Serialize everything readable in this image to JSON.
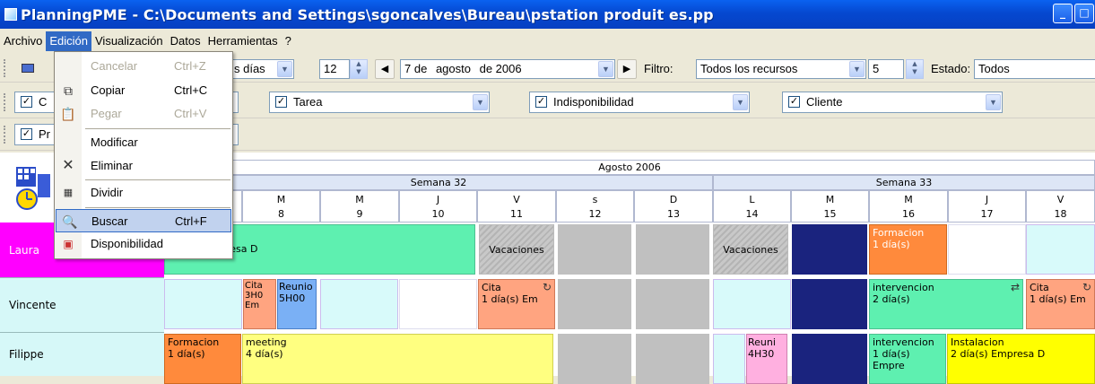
{
  "window": {
    "title": "PlanningPME - C:\\Documents and Settings\\sgoncalves\\Bureau\\pstation produit es.pp",
    "minimize": "_",
    "restore": "□"
  },
  "menubar": [
    "Archivo",
    "Edición",
    "Visualización",
    "Datos",
    "Herramientas",
    "?"
  ],
  "edit_menu": {
    "items": [
      {
        "label": "Cancelar",
        "shortcut": "Ctrl+Z",
        "disabled": true,
        "icon": ""
      },
      {
        "label": "Copiar",
        "shortcut": "Ctrl+C",
        "disabled": false,
        "icon": "copy-icon"
      },
      {
        "label": "Pegar",
        "shortcut": "Ctrl+V",
        "disabled": true,
        "icon": "paste-icon"
      },
      {
        "label": "Modificar",
        "shortcut": "",
        "disabled": false,
        "icon": ""
      },
      {
        "label": "Eliminar",
        "shortcut": "",
        "disabled": false,
        "icon": "delete-icon"
      },
      {
        "label": "Dividir",
        "shortcut": "",
        "disabled": false,
        "icon": "split-icon"
      },
      {
        "label": "Buscar",
        "shortcut": "Ctrl+F",
        "disabled": false,
        "icon": "search-icon"
      },
      {
        "label": "Disponibilidad",
        "shortcut": "",
        "disabled": false,
        "icon": "availability-icon"
      }
    ]
  },
  "toolbar": {
    "view_combo": "s días",
    "days_count": "12",
    "date_day": "7 de",
    "date_month": "agosto",
    "date_year": "de 2006",
    "filter_label": "Filtro:",
    "filter_value": "Todos los recursos",
    "filter_count": "5",
    "state_label": "Estado:",
    "state_value": "Todos"
  },
  "filters_row1": {
    "first_partial": "C",
    "task": "Tarea",
    "unavailability": "Indisponibilidad",
    "client": "Cliente"
  },
  "filters_row2": {
    "first_partial": "Pr"
  },
  "calendar": {
    "month": "Agosto 2006",
    "weeks": [
      "Semana 32",
      "Semana 33"
    ],
    "days": [
      {
        "d": "M",
        "n": "8"
      },
      {
        "d": "M",
        "n": "9"
      },
      {
        "d": "J",
        "n": "10"
      },
      {
        "d": "V",
        "n": "11"
      },
      {
        "d": "s",
        "n": "12"
      },
      {
        "d": "D",
        "n": "13"
      },
      {
        "d": "L",
        "n": "14"
      },
      {
        "d": "M",
        "n": "15"
      },
      {
        "d": "M",
        "n": "16"
      },
      {
        "d": "J",
        "n": "17"
      },
      {
        "d": "V",
        "n": "18"
      }
    ]
  },
  "resources": [
    {
      "name": "Laura",
      "tasks": {
        "t1": "resa D",
        "vac1": "Vacaciones",
        "vac2": "Vacaciones",
        "formacion": "Formacion",
        "formacion_dur": "1 día(s)"
      }
    },
    {
      "name": "Vincente",
      "tasks": {
        "cita_a": "Cita 3H0 Em",
        "reunion": "Reunio 5H00",
        "cita_b": "Cita",
        "cita_b_dur": "1 día(s)  Em",
        "interv": "intervencion",
        "interv_dur": "2 día(s)",
        "cita_c": "Cita",
        "cita_c_dur": "1 día(s)  Em"
      }
    },
    {
      "name": "Filippe",
      "tasks": {
        "formacion": "Formacion",
        "formacion_dur": "1 día(s)",
        "meeting": "meeting",
        "meeting_dur": "4 día(s)",
        "reunion": "Reuni",
        "reunion_dur": "4H30",
        "interv": "intervencion",
        "interv_dur": "1 día(s)  Empre",
        "instal": "Instalacion",
        "instal_dur": "2 día(s)  Empresa D"
      }
    }
  ]
}
